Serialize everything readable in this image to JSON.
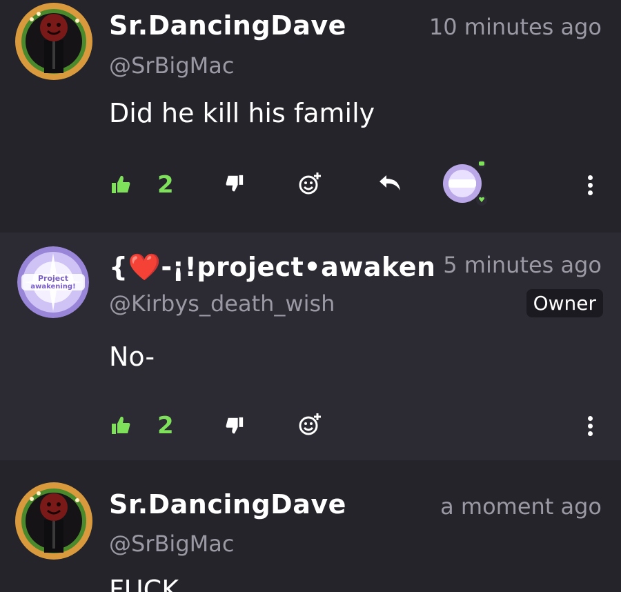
{
  "comments": [
    {
      "author": "Sr.DancingDave",
      "handle": "@SrBigMac",
      "time": "10 minutes ago",
      "text": "Did he kill his family",
      "likes": "2"
    },
    {
      "author": "{❤️-¡!project•awakenin",
      "handle": "@Kirbys_death_wish",
      "time": "5 minutes ago",
      "badge": "Owner",
      "text": "No-",
      "likes": "2",
      "avatar_text": [
        "Project",
        "awakening!"
      ]
    },
    {
      "author": "Sr.DancingDave",
      "handle": "@SrBigMac",
      "time": "a moment ago",
      "text": "FUCK"
    }
  ],
  "colors": {
    "like_green": "#7fe05c",
    "muted_text": "#9a99a4",
    "background": "#25242b"
  },
  "icons": [
    "thumbs-up-icon",
    "thumbs-down-icon",
    "add-reaction-icon",
    "reply-icon",
    "more-options-icon"
  ]
}
